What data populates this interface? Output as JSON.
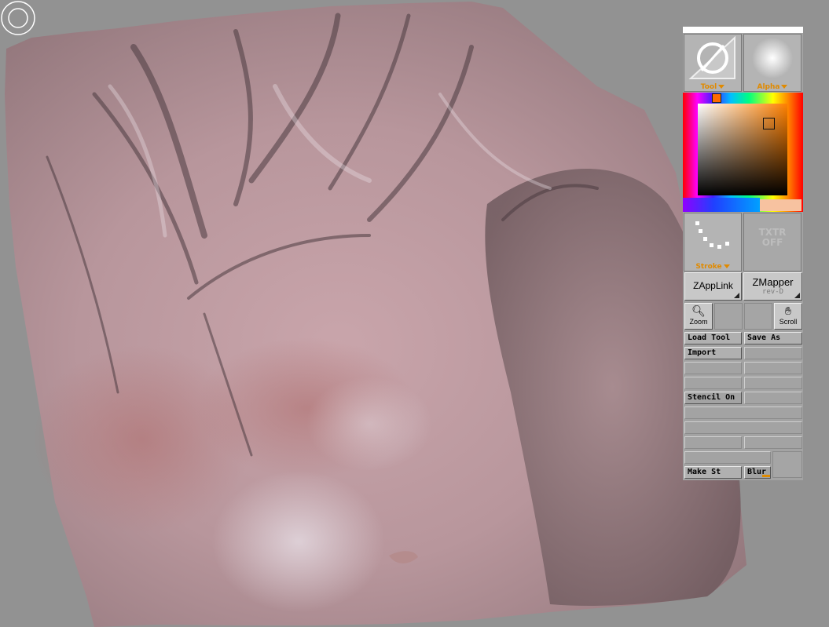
{
  "viewport": {
    "background": "#929292",
    "model": "sculpted-torso"
  },
  "palette": {
    "tool_label": "Tool",
    "alpha_label": "Alpha",
    "stroke_label": "Stroke",
    "texture_label": "TXTR OFF",
    "zapplink_label": "ZAppLink",
    "zmapper_label": "ZMapper",
    "zmapper_sub": "rev-D",
    "zoom_label": "Zoom",
    "scroll_label": "Scroll",
    "load_tool_label": "Load Tool",
    "save_as_label": "Save As",
    "import_label": "Import",
    "stencil_on_label": "Stencil On",
    "make_st_label": "Make St",
    "blur_label": "Blur",
    "colors": {
      "accent": "#e08a00",
      "secondary_color": "#f7c2a0",
      "selected_hue": "#ff6a00"
    }
  }
}
